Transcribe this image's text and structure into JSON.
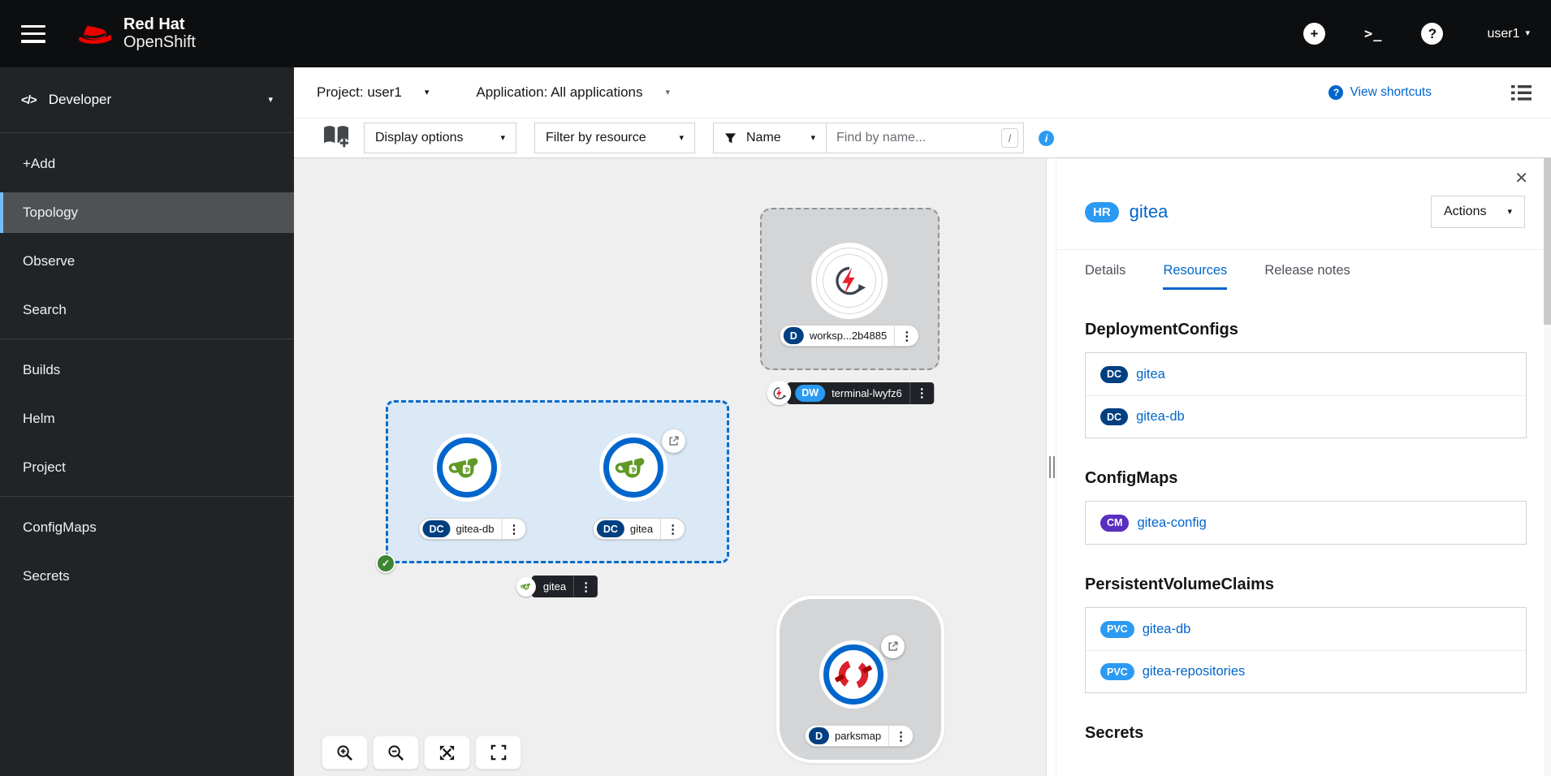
{
  "masthead": {
    "logo_line1": "Red Hat",
    "logo_line2": "OpenShift",
    "user": "user1"
  },
  "sidebar": {
    "perspective": "Developer",
    "items": [
      "+Add",
      "Topology",
      "Observe",
      "Search",
      "Builds",
      "Helm",
      "Project",
      "ConfigMaps",
      "Secrets"
    ]
  },
  "context_bar": {
    "project": "Project: user1",
    "application": "Application: All applications",
    "view_shortcuts": "View shortcuts"
  },
  "toolbar": {
    "display_options": "Display options",
    "filter_by_resource": "Filter by resource",
    "name_filter": "Name",
    "find_placeholder": "Find by name...",
    "shortcut_key": "/"
  },
  "topology": {
    "workspace_node": {
      "badge": "D",
      "label": "worksp...2b4885"
    },
    "terminal_label": {
      "badge": "DW",
      "label": "terminal-lwyfz6"
    },
    "gitea_db_node": {
      "badge": "DC",
      "label": "gitea-db"
    },
    "gitea_node": {
      "badge": "DC",
      "label": "gitea"
    },
    "application_label": "gitea",
    "parksmap_node": {
      "badge": "D",
      "label": "parksmap"
    }
  },
  "side_panel": {
    "badge": "HR",
    "title": "gitea",
    "actions_label": "Actions",
    "tabs": [
      "Details",
      "Resources",
      "Release notes"
    ],
    "active_tab": "Resources",
    "sections": [
      {
        "heading": "DeploymentConfigs",
        "items": [
          {
            "badge": "DC",
            "name": "gitea"
          },
          {
            "badge": "DC",
            "name": "gitea-db"
          }
        ]
      },
      {
        "heading": "ConfigMaps",
        "items": [
          {
            "badge": "CM",
            "name": "gitea-config"
          }
        ]
      },
      {
        "heading": "PersistentVolumeClaims",
        "items": [
          {
            "badge": "PVC",
            "name": "gitea-db"
          },
          {
            "badge": "PVC",
            "name": "gitea-repositories"
          }
        ]
      },
      {
        "heading": "Secrets",
        "items": []
      }
    ]
  },
  "icons": {
    "caret_down": "▾",
    "kebab": "⋮",
    "close": "✕",
    "plus": "+",
    "help": "?",
    "terminal": ">_",
    "code": "</>",
    "info": "i",
    "check": "✓",
    "slash": "/"
  },
  "colors": {
    "accent_blue": "#0066cc",
    "light_blue": "#2b9af3",
    "navy_badge": "#004080",
    "purple_badge": "#582fc0",
    "gitea_green": "#609926",
    "brand_red": "#ee0000",
    "status_green": "#3e8635"
  }
}
